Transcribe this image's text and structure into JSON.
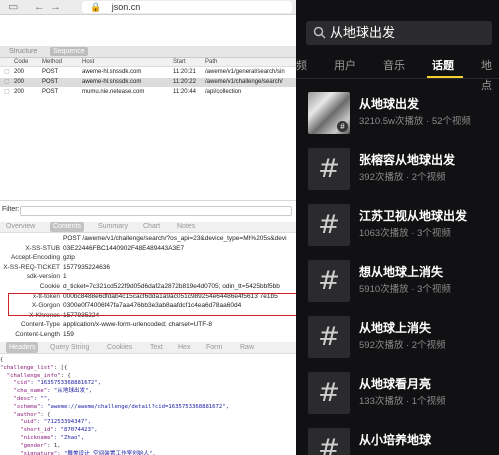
{
  "browser": {
    "url": "json.cn"
  },
  "structure_tabs": [
    "Structure",
    "Sequence"
  ],
  "requests": {
    "headers": [
      "Code",
      "Method",
      "Host",
      "Start",
      "Path"
    ],
    "rows": [
      {
        "code": "200",
        "method": "POST",
        "host": "aweme-hl.snssdk.com",
        "start": "11:20:21",
        "path": "/aweme/v1/general/search/sin"
      },
      {
        "code": "200",
        "method": "POST",
        "host": "aweme-hl.snssdk.com",
        "start": "11:20:22",
        "path": "/aweme/v1/challenge/search/"
      },
      {
        "code": "200",
        "method": "POST",
        "host": "mumu.nie.netease.com",
        "start": "11:20:44",
        "path": "/api/collection"
      }
    ]
  },
  "filter_label": "Filter:",
  "detail_tabs": [
    "Overview",
    "Contents",
    "Summary",
    "Chart",
    "Notes"
  ],
  "request_headers": [
    {
      "key": "",
      "value": "POST /aweme/v1/challenge/search/?os_api=23&device_type=MI%205s&devi"
    },
    {
      "key": "X-SS-STUB",
      "value": "03E22446FBC1440902F48E489443A3E7"
    },
    {
      "key": "Accept-Encoding",
      "value": "gzip"
    },
    {
      "key": "X-SS-REQ-TICKET",
      "value": "1577935224636"
    },
    {
      "key": "sdk-version",
      "value": "1"
    },
    {
      "key": "Cookie",
      "value": "d_ticket=7c321cd522f9d05d6daf2a2872b819e4d0705; odin_tt=5425bbf5bb"
    },
    {
      "key": "x-tt-token",
      "value": "000bc8488e6dfdab4c15cacf6dda1a9ac051c989254e64486e4f5613 7e1b5"
    },
    {
      "key": "X-Gorgon",
      "value": "0300e0f74006f47fa7aa476bb3e3ab8aafdcf1c4ea6d78aa60d4"
    },
    {
      "key": "X-Khronos",
      "value": "1577935224"
    },
    {
      "key": "Content-Type",
      "value": "application/x-www-form-urlencoded; charset=UTF-8"
    },
    {
      "key": "Content-Length",
      "value": "159"
    }
  ],
  "body_tabs": [
    "Headers",
    "Query String",
    "Cookies",
    "Text",
    "Hex",
    "Form",
    "Raw"
  ],
  "json_lines": [
    {
      "text": "{"
    },
    {
      "key": "\"challenge_list\"",
      "rest": ": [{"
    },
    {
      "key": "  \"challenge_info\"",
      "rest": ": {"
    },
    {
      "key": "    \"cid\"",
      "str": ": \"1635753368881672\","
    },
    {
      "key": "    \"cha_name\"",
      "str": ": \"从地球出发\","
    },
    {
      "key": "    \"desc\"",
      "str": ": \"\","
    },
    {
      "key": "    \"schema\"",
      "str": ": \"aweme://aweme/challenge/detail?cid=1635753368881672\","
    },
    {
      "key": "    \"author\"",
      "rest": ": {"
    },
    {
      "key": "      \"uid\"",
      "str": ": \"71253394347\","
    },
    {
      "key": "      \"short_id\"",
      "str": ": \"87074423\","
    },
    {
      "key": "      \"nickname\"",
      "str": ": \"Zhao\","
    },
    {
      "key": "      \"gender\"",
      "rest": ": 1,"
    },
    {
      "key": "      \"signature\"",
      "str": ": \"舞美设计 空间装置工作室创始人\","
    }
  ],
  "app": {
    "search_query": "从地球出发",
    "tabs": [
      "频",
      "用户",
      "音乐",
      "话题",
      "地点"
    ],
    "active_tab": "话题",
    "accent_color": "#f7ce2f",
    "topics": [
      {
        "name": "从地球出发",
        "stats": "3210.5w次播放 · 52个视频",
        "has_image": true
      },
      {
        "name": "张榕容从地球出发",
        "stats": "392次播放 · 2个视频",
        "has_image": false
      },
      {
        "name": "江苏卫视从地球出发",
        "stats": "1063次播放 · 3个视频",
        "has_image": false
      },
      {
        "name": "想从地球上消失",
        "stats": "5910次播放 · 3个视频",
        "has_image": false
      },
      {
        "name": "从地球上消失",
        "stats": "592次播放 · 2个视频",
        "has_image": false
      },
      {
        "name": "从地球看月亮",
        "stats": "133次播放 · 1个视频",
        "has_image": false
      },
      {
        "name": "从小培养地球",
        "stats": "",
        "has_image": false
      }
    ]
  }
}
